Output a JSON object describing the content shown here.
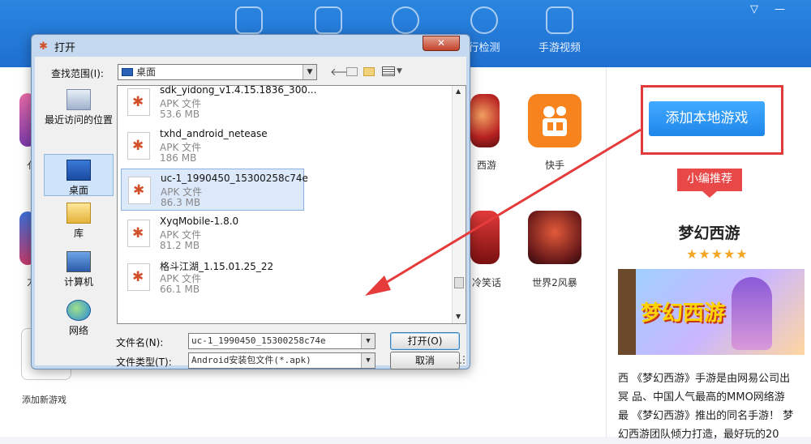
{
  "nav": {
    "tabs": [
      {
        "label": "",
        "icon": "gamepad-icon"
      },
      {
        "label": "",
        "icon": "apps-grid-icon"
      },
      {
        "label": "",
        "icon": "user-icon"
      },
      {
        "label": "行检测",
        "icon": "gear-icon"
      },
      {
        "label": "手游视频",
        "icon": "film-icon"
      }
    ],
    "window_controls": [
      "▽",
      "—"
    ]
  },
  "games": [
    {
      "label": "西游",
      "color": "#b82222"
    },
    {
      "label": "快手",
      "color": "#f7831e"
    },
    {
      "label": "冷笑话",
      "color": "#c23030"
    },
    {
      "label": "世界2风暴",
      "color": "#8a2a2a"
    }
  ],
  "add_new_game_label": "添加新游戏",
  "left_partial_labels": [
    "亻",
    "力"
  ],
  "right_panel": {
    "add_button": "添加本地游戏",
    "recommend": "小编推荐",
    "title": "梦幻西游",
    "stars": "★★★★★",
    "banner_text": "梦幻西游",
    "desc": [
      "西  《梦幻西游》手游是由网易公司出",
      "冥  品、中国人气最高的MMO网络游",
      "最  《梦幻西游》推出的同名手游！ 梦",
      "    幻西游团队倾力打造，最好玩的20"
    ]
  },
  "dialog": {
    "title": "打开",
    "close": "✕",
    "look_in_label": "查找范围(I):",
    "look_in_value": "桌面",
    "places": [
      {
        "label": "最近访问的位置",
        "icon": "recent-icon"
      },
      {
        "label": "桌面",
        "icon": "desktop-icon"
      },
      {
        "label": "库",
        "icon": "library-icon"
      },
      {
        "label": "计算机",
        "icon": "computer-icon"
      },
      {
        "label": "网络",
        "icon": "network-icon"
      }
    ],
    "files": [
      {
        "name": "sdk_yidong_v1.4.15.1836_300...",
        "type": "APK 文件",
        "size": "53.6 MB"
      },
      {
        "name": "txhd_android_netease",
        "type": "APK 文件",
        "size": "186 MB"
      },
      {
        "name": "uc-1_1990450_15300258c74e",
        "type": "APK 文件",
        "size": "86.3 MB"
      },
      {
        "name": "XyqMobile-1.8.0",
        "type": "APK 文件",
        "size": "81.2 MB"
      },
      {
        "name": "格斗江湖_1.15.01.25_22",
        "type": "APK 文件",
        "size": "66.1 MB"
      }
    ],
    "selected_file_index": 2,
    "filename_label": "文件名(N):",
    "filename_value": "uc-1_1990450_15300258c74e",
    "filetype_label": "文件类型(T):",
    "filetype_value": "Android安装包文件(*.apk)",
    "open_button": "打开(O)",
    "cancel_button": "取消"
  },
  "colors": {
    "appbar": "#1f6fd0",
    "accent_button": "#2b93f0",
    "highlight": "#e23a3a",
    "arrow": "#e53b3b"
  }
}
